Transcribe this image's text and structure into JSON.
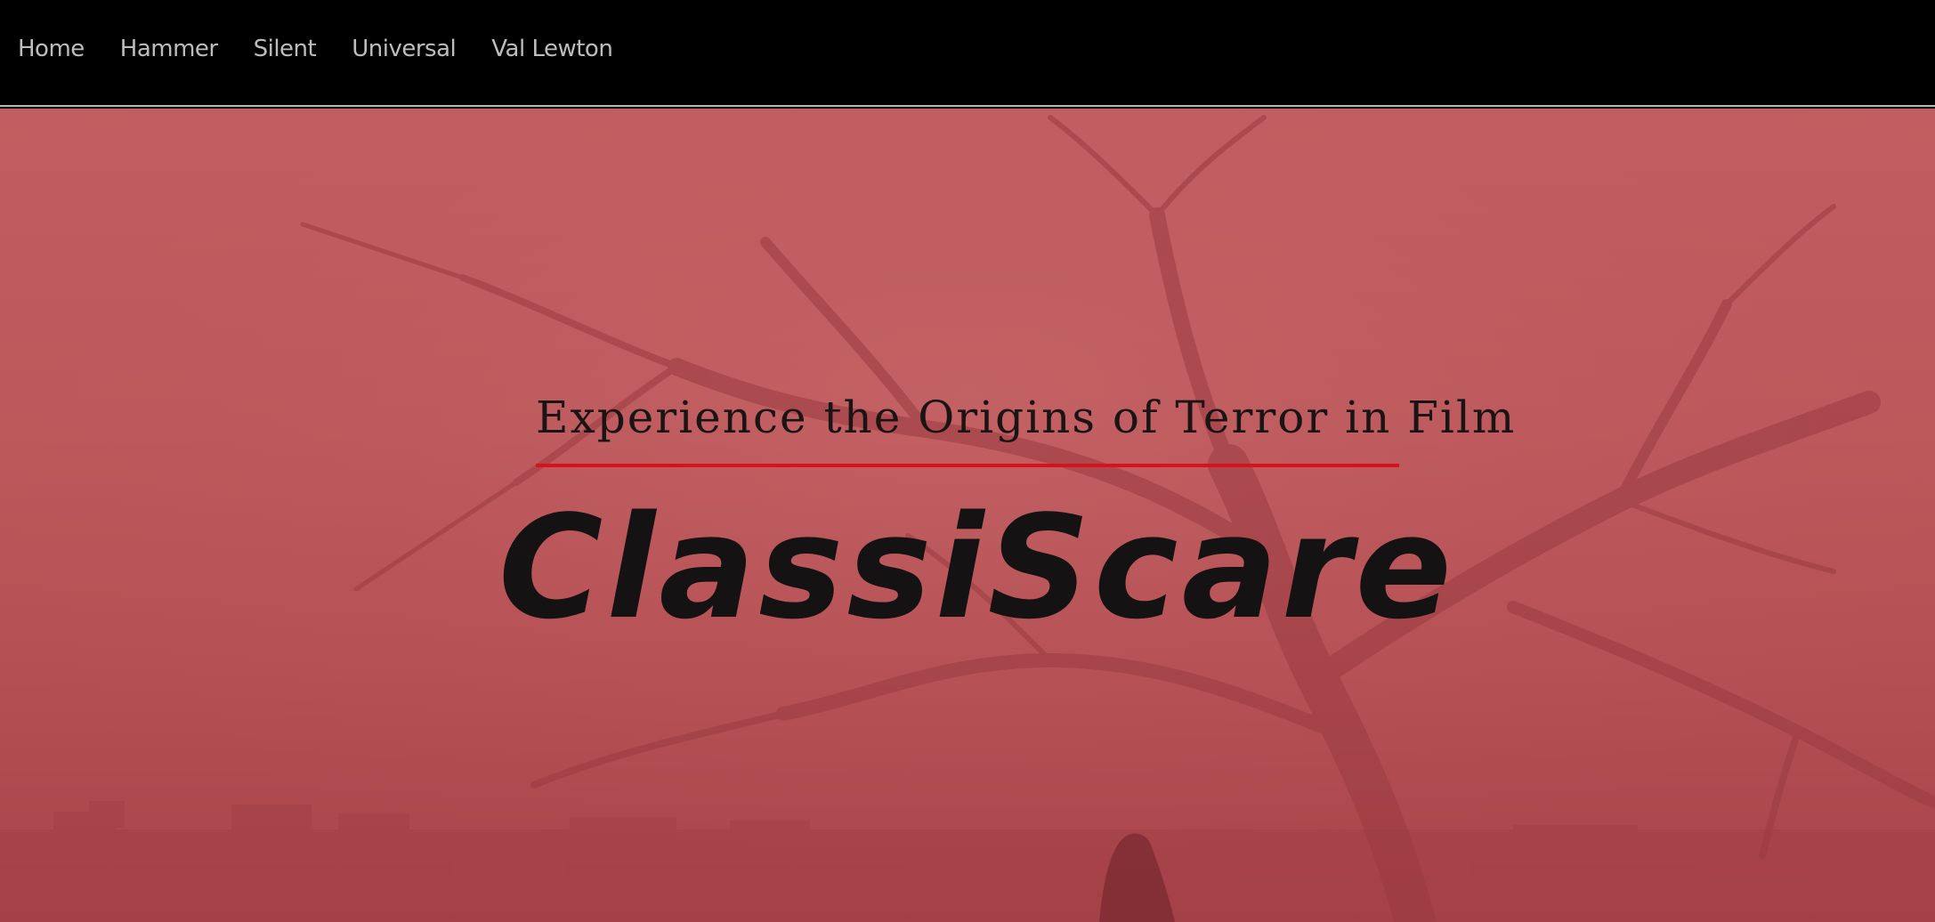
{
  "nav": {
    "items": [
      {
        "label": "Home"
      },
      {
        "label": "Hammer"
      },
      {
        "label": "Silent"
      },
      {
        "label": "Universal"
      },
      {
        "label": "Val Lewton"
      }
    ]
  },
  "hero": {
    "subtitle": "Experience the Origins of Terror in Film",
    "brand": "ClassiScare"
  },
  "colors": {
    "nav_background": "#000000",
    "nav_text": "#bdbdbd",
    "hero_tint": "#bd585b",
    "divider": "#d8111c",
    "heading_text": "#141212"
  },
  "icons": {
    "hero_background": "foggy-dead-tree-image"
  }
}
